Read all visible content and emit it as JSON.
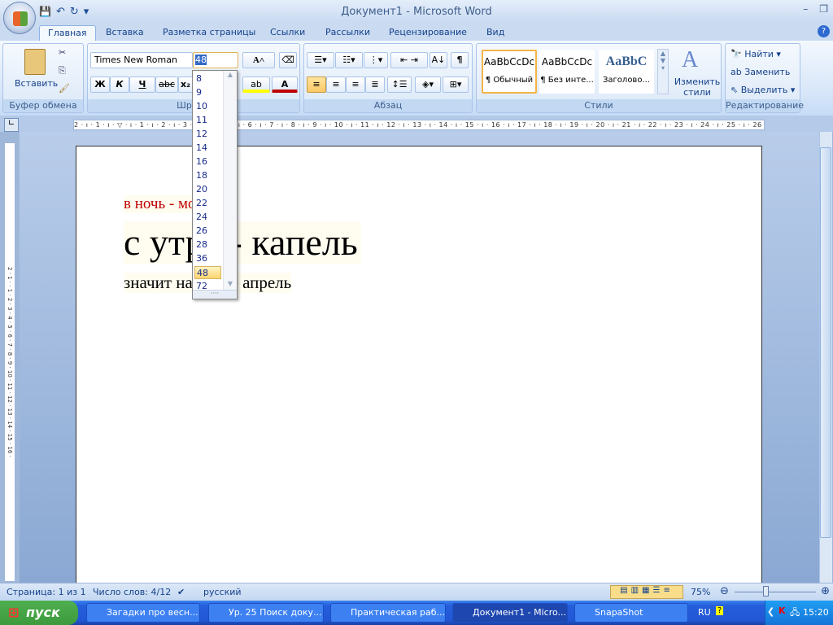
{
  "window": {
    "title": "Документ1 - Microsoft Word",
    "controls": [
      "–",
      "❐"
    ]
  },
  "qat": {
    "save": "💾",
    "undo": "↶",
    "redo": "↻",
    "more": "▾"
  },
  "tabs": [
    {
      "label": "Главная",
      "active": true
    },
    {
      "label": "Вставка"
    },
    {
      "label": "Разметка страницы"
    },
    {
      "label": "Ссылки"
    },
    {
      "label": "Рассылки"
    },
    {
      "label": "Рецензирование"
    },
    {
      "label": "Вид"
    }
  ],
  "help": "?",
  "ribbon": {
    "clipboard": {
      "label": "Буфер обмена",
      "paste": "Вставить"
    },
    "font": {
      "label": "Шрифт",
      "font_name": "Times New Roman",
      "font_size": "48",
      "bold": "Ж",
      "italic": "К",
      "underline": "Ч",
      "strike": "abc",
      "subscript": "x₂",
      "grow": "A˄",
      "shrink": "A˅",
      "highlight": "ab",
      "color": "A",
      "highlight_color": "#ffff00",
      "font_color": "#c00000"
    },
    "paragraph": {
      "label": "Абзац",
      "pilcrow": "¶",
      "sort": "А↓"
    },
    "styles": {
      "label": "Стили",
      "items": [
        {
          "preview": "AaBbCcDc",
          "name": "¶ Обычный",
          "selected": true
        },
        {
          "preview": "AaBbCcDc",
          "name": "¶ Без инте..."
        },
        {
          "preview": "AaBbC",
          "name": "Заголово..."
        }
      ],
      "change": "Изменить стили"
    },
    "editing": {
      "label": "Редактирование",
      "find": "Найти",
      "replace": "Заменить",
      "select": "Выделить"
    }
  },
  "font_size_dropdown": {
    "options": [
      "8",
      "9",
      "10",
      "11",
      "12",
      "14",
      "16",
      "18",
      "20",
      "22",
      "24",
      "26",
      "28",
      "36",
      "48",
      "72"
    ],
    "selected": "48"
  },
  "ruler": {
    "marks": "2 · ı · 1 · ı · ▽ · ı · 1 · ı · 2 · ı · 3 · ı · 4 · ı · 5 · ı · 6 · ı · 7 · ı · 8 · ı · 9 · ı · 10 · ı · 11 · ı · 12 · ı · 13 · ı · 14 · ı · 15 · ı · 16 · ı · 17 · ı · 18 · ı · 19 · ı · 20 · ı · 21 · ı · 22 · ı · 23 · ı · 24 · ı · 25 · ı · 26 · ı · 27 · ı",
    "vmarks": "2 · 1 · · 1 · 2 · 3 · 4 · 5 · 6 · 7 · 8 · 9 · 10 · 11 · 12 · 13 · 14 · 15 · 16 ·"
  },
  "document": {
    "lines": [
      "в ночь - мороз",
      "с утра - капель",
      "значит  на дворе апрель"
    ],
    "line1_color": "#c00000"
  },
  "status": {
    "page": "Страница: 1 из 1",
    "words": "Число слов: 4/12",
    "language": "русский",
    "zoom": "75%",
    "zoom_percent": 75
  },
  "taskbar": {
    "start": "пуск",
    "tasks": [
      {
        "label": "Загадки про весн..."
      },
      {
        "label": "Ур. 25 Поиск доку..."
      },
      {
        "label": "Практическая раб..."
      },
      {
        "label": "Документ1 - Micro...",
        "active": true
      },
      {
        "label": "SnapaShot"
      }
    ],
    "lang": "RU",
    "clock": "15:20"
  }
}
